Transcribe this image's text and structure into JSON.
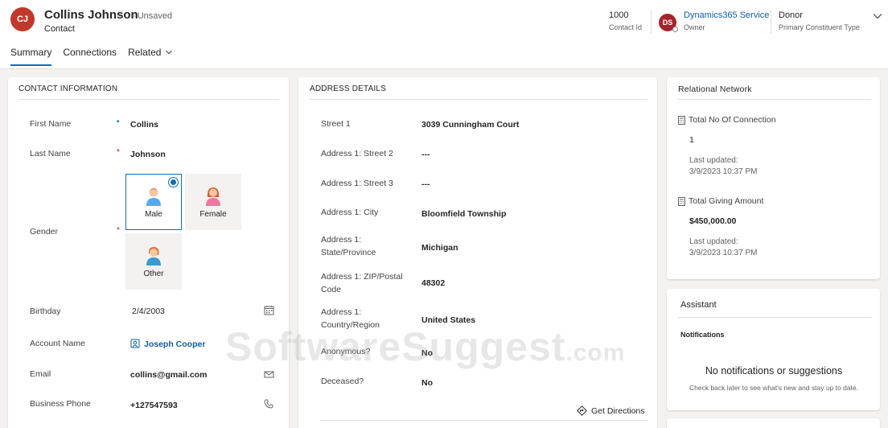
{
  "record": {
    "initials": "CJ",
    "name": "Collins Johnson",
    "status": "- Unsaved",
    "entity": "Contact"
  },
  "header_fields": {
    "contact_id_value": "1000",
    "contact_id_label": "Contact Id",
    "owner_initials": "DS",
    "owner_value": "Dynamics365 Service",
    "owner_label": "Owner",
    "constituent_value": "Donor",
    "constituent_label": "Primary Constituent Type"
  },
  "tabs": [
    {
      "label": "Summary",
      "active": true
    },
    {
      "label": "Connections",
      "active": false
    },
    {
      "label": "Related",
      "active": false
    }
  ],
  "contact_info": {
    "title": "CONTACT INFORMATION",
    "first_name_label": "First Name",
    "first_name_value": "Collins",
    "last_name_label": "Last Name",
    "last_name_value": "Johnson",
    "gender_label": "Gender",
    "gender_options": [
      "Male",
      "Female",
      "Other"
    ],
    "gender_selected": "Male",
    "birthday_label": "Birthday",
    "birthday_value": "2/4/2003",
    "account_label": "Account Name",
    "account_value": "Joseph Cooper",
    "email_label": "Email",
    "email_value": "collins@gmail.com",
    "phone_label": "Business Phone",
    "phone_value": "+127547593"
  },
  "address": {
    "title": "ADDRESS DETAILS",
    "rows": [
      {
        "label": "Street 1",
        "value": "3039 Cunningham Court"
      },
      {
        "label": "Address 1: Street 2",
        "value": "---"
      },
      {
        "label": "Address 1: Street 3",
        "value": "---"
      },
      {
        "label": "Address 1: City",
        "value": "Bloomfield Township"
      },
      {
        "label": "Address 1: State/Province",
        "value": "Michigan"
      },
      {
        "label": "Address 1: ZIP/Postal Code",
        "value": "48302"
      },
      {
        "label": "Address 1: Country/Region",
        "value": "United States"
      },
      {
        "label": "Anonymous?",
        "value": "No"
      },
      {
        "label": "Deceased?",
        "value": "No"
      }
    ],
    "directions_label": "Get Directions"
  },
  "relational_network": {
    "title": "Relational Network",
    "connections_label": "Total No Of Connection",
    "connections_value": "1",
    "connections_updated_label": "Last updated:",
    "connections_updated_value": "3/9/2023 10:37 PM",
    "giving_label": "Total Giving Amount",
    "giving_value": "$450,000.00",
    "giving_updated_label": "Last updated:",
    "giving_updated_value": "3/9/2023 10:37 PM"
  },
  "assistant": {
    "title": "Assistant",
    "subtitle": "Notifications",
    "empty_message": "No notifications or suggestions",
    "empty_hint": "Check back later to see what's new and stay up to date."
  },
  "watermark": {
    "text": "SoftwareSuggest",
    "suffix": ".com"
  },
  "colors": {
    "accent": "#0f6cbd",
    "avatar_cj": "#c0392b",
    "avatar_ds": "#a4262c",
    "required": "#c50f1f"
  }
}
